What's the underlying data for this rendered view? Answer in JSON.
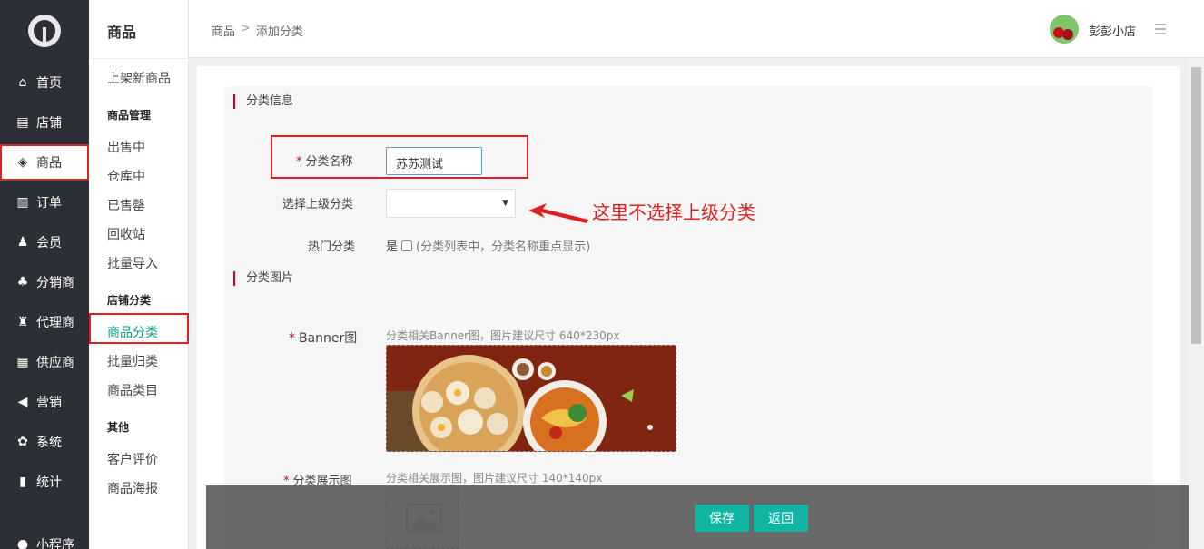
{
  "leftnav": {
    "items": [
      {
        "label": "首页",
        "icon": "home-icon",
        "glyph": "⌂"
      },
      {
        "label": "店铺",
        "icon": "store-icon",
        "glyph": "▤"
      },
      {
        "label": "商品",
        "icon": "box-icon",
        "glyph": "◈"
      },
      {
        "label": "订单",
        "icon": "basket-icon",
        "glyph": "▥"
      },
      {
        "label": "会员",
        "icon": "user-icon",
        "glyph": "♟"
      },
      {
        "label": "分销商",
        "icon": "sitemap-icon",
        "glyph": "♣"
      },
      {
        "label": "代理商",
        "icon": "agent-icon",
        "glyph": "♜"
      },
      {
        "label": "供应商",
        "icon": "building-icon",
        "glyph": "▦"
      },
      {
        "label": "营销",
        "icon": "megaphone-icon",
        "glyph": "◀"
      },
      {
        "label": "系统",
        "icon": "gear-icon",
        "glyph": "✿"
      },
      {
        "label": "统计",
        "icon": "bar-chart-icon",
        "glyph": "▮"
      },
      {
        "label": "小程序",
        "icon": "miniapp-icon",
        "glyph": "●"
      }
    ]
  },
  "subnav": {
    "title": "商品",
    "publish": "上架新商品",
    "group_manage": "商品管理",
    "on_sale": "出售中",
    "warehouse": "仓库中",
    "sold_out": "已售罄",
    "recycle": "回收站",
    "batch_import": "批量导入",
    "group_category": "店铺分类",
    "category": "商品分类",
    "batch_categorize": "批量归类",
    "product_catalog": "商品类目",
    "group_other": "其他",
    "reviews": "客户评价",
    "posters": "商品海报"
  },
  "header": {
    "breadcrumb_root": "商品",
    "breadcrumb_sep": ">",
    "breadcrumb_current": "添加分类",
    "shop_name": "彭彭小店"
  },
  "form": {
    "section_info": "分类信息",
    "name_label": "分类名称",
    "name_value": "苏苏测试",
    "parent_label": "选择上级分类",
    "parent_value": "",
    "annotation": "这里不选择上级分类",
    "hot_label": "热门分类",
    "hot_yes": "是",
    "hot_hint": "(分类列表中，分类名称重点显示)",
    "section_image": "分类图片",
    "banner_label": "Banner图",
    "banner_tip": "分类相关Banner图，图片建议尺寸 640*230px",
    "display_label": "分类展示图",
    "display_tip": "分类相关展示图，图片建议尺寸 140*140px",
    "required_mark": "*"
  },
  "footer": {
    "save": "保存",
    "back": "返回"
  },
  "colors": {
    "nav_bg": "#2c2f36",
    "accent": "#12b5a4",
    "required": "#d9001b",
    "highlight": "#e02020"
  }
}
